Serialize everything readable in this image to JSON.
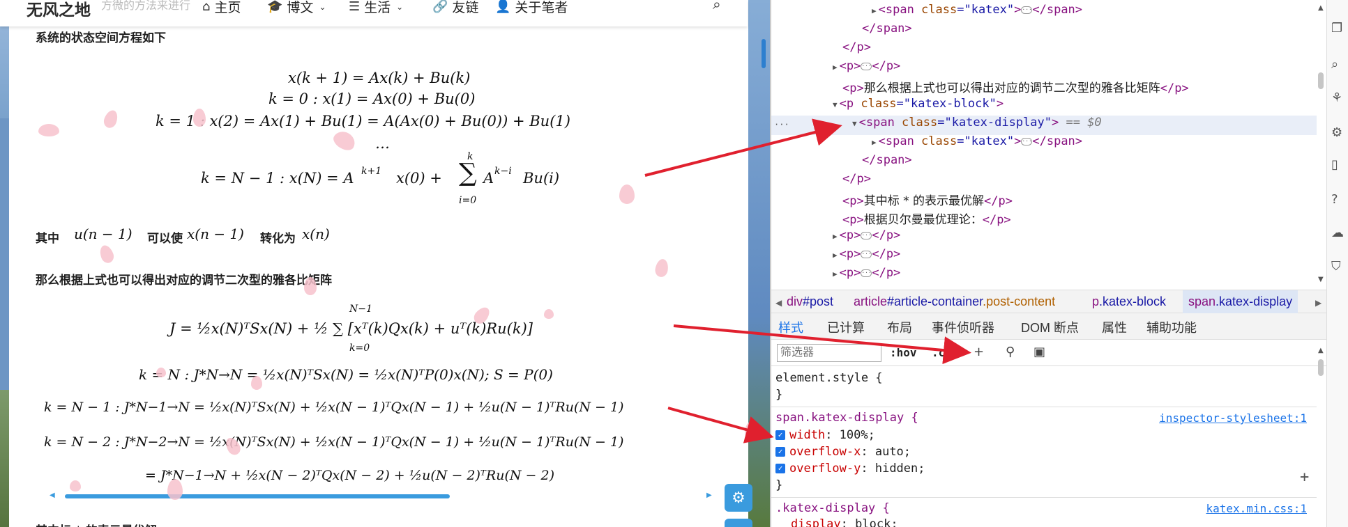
{
  "site": {
    "brand": "无风之地",
    "faded_text": "方微的方法来进行",
    "nav": [
      {
        "label": "主页",
        "icon": "home-icon",
        "glyph": "⌂",
        "dropdown": false
      },
      {
        "label": "博文",
        "icon": "graduation-cap-icon",
        "glyph": "🎓",
        "dropdown": true
      },
      {
        "label": "生活",
        "icon": "list-icon",
        "glyph": "☰",
        "dropdown": true
      },
      {
        "label": "友链",
        "icon": "link-icon",
        "glyph": "🔗",
        "dropdown": false
      },
      {
        "label": "关于笔者",
        "icon": "user-icon",
        "glyph": "👤",
        "dropdown": false
      }
    ],
    "search_icon": "⌕"
  },
  "article": {
    "p1": "系统的状态空间方程如下",
    "eq1": "x(k + 1) = Ax(k) + Bu(k)",
    "eq2": "k = 0 :  x(1) = Ax(0) + Bu(0)",
    "eq3": "k = 1 :  x(2) = Ax(1) + Bu(1) = A(Ax(0) + Bu(0)) + Bu(1)",
    "eq4": "…",
    "eq5_a": "k = N − 1 :  x(N) = A",
    "eq5_a_sup": "k+1",
    "eq5_b": "x(0) +",
    "eq5_sum": "∑",
    "eq5_sum_top": "k",
    "eq5_sum_bot": "i=0",
    "eq5_c": "A",
    "eq5_c_sup": "k−i",
    "eq5_d": "Bu(i)",
    "p2_pre": "其中",
    "p2_m1": "u(n − 1)",
    "p2_mid": "可以使",
    "p2_m2": "x(n − 1)",
    "p2_mid2": "转化为",
    "p2_m3": "x(n)",
    "p3": "那么根据上式也可以得出对应的调节二次型的雅各比矩阵",
    "eqJ": "J = ½x(N)ᵀSx(N) + ½ ∑ [xᵀ(k)Qx(k) + uᵀ(k)Ru(k)]",
    "eqJ_sum_top": "N−1",
    "eqJ_sum_bot": "k=0",
    "eqN": "k = N : J*N→N = ½x(N)ᵀSx(N) = ½x(N)ᵀP(0)x(N);  S = P(0)",
    "eqN1": "k = N − 1 : J*N−1→N = ½x(N)ᵀSx(N) + ½x(N − 1)ᵀQx(N − 1) + ½u(N − 1)ᵀRu(N − 1)",
    "eqN2": "k = N − 2 : J*N−2→N = ½x(N)ᵀSx(N) + ½x(N − 1)ᵀQx(N − 1) + ½u(N − 1)ᵀRu(N − 1)",
    "eqN2b": "= J*N−1→N + ½x(N − 2)ᵀQx(N − 2) + ½u(N − 2)ᵀRu(N − 2)",
    "p4_partial": "其中标 * 的表示最优解"
  },
  "devtools": {
    "elements": [
      {
        "indent": 1,
        "tri": "▶",
        "open": "<span",
        "attr": "class",
        "val": "katex",
        "close": ">",
        "ell": true,
        "end": "</span>"
      },
      {
        "indent": 0,
        "tri": "",
        "open": "</span>",
        "attr": "",
        "val": "",
        "close": "",
        "ell": false,
        "end": ""
      },
      {
        "indent": -1,
        "tri": "",
        "open": "</p>",
        "attr": "",
        "val": "",
        "close": "",
        "ell": false,
        "end": ""
      },
      {
        "indent": -1,
        "tri": "▶",
        "open": "<p>",
        "attr": "",
        "val": "",
        "close": "",
        "ell": true,
        "end": "</p>"
      },
      {
        "indent": -1,
        "tri": "",
        "open": "<p>",
        "attr": "",
        "val": "",
        "close": "",
        "ell": false,
        "end": "</p>",
        "text": "那么根据上式也可以得出对应的调节二次型的雅各比矩阵"
      },
      {
        "indent": -1,
        "tri": "▼",
        "open": "<p",
        "attr": "class",
        "val": "katex-block",
        "close": ">",
        "ell": false,
        "end": ""
      },
      {
        "indent": 0,
        "tri": "▼",
        "open": "<span",
        "attr": "class",
        "val": "katex-display",
        "close": ">",
        "ell": false,
        "end": "",
        "eq": "== $0"
      },
      {
        "indent": 1,
        "tri": "▶",
        "open": "<span",
        "attr": "class",
        "val": "katex",
        "close": ">",
        "ell": true,
        "end": "</span>"
      },
      {
        "indent": 0,
        "tri": "",
        "open": "</span>",
        "attr": "",
        "val": "",
        "close": "",
        "ell": false,
        "end": ""
      },
      {
        "indent": -1,
        "tri": "",
        "open": "</p>",
        "attr": "",
        "val": "",
        "close": "",
        "ell": false,
        "end": ""
      },
      {
        "indent": -1,
        "tri": "",
        "open": "<p>",
        "attr": "",
        "val": "",
        "close": "",
        "ell": false,
        "end": "</p>",
        "text": "其中标 * 的表示最优解"
      },
      {
        "indent": -1,
        "tri": "",
        "open": "<p>",
        "attr": "",
        "val": "",
        "close": "",
        "ell": false,
        "end": "</p>",
        "text": "根据贝尔曼最优理论："
      },
      {
        "indent": -1,
        "tri": "▶",
        "open": "<p>",
        "attr": "",
        "val": "",
        "close": "",
        "ell": true,
        "end": "</p>"
      },
      {
        "indent": -1,
        "tri": "▶",
        "open": "<p>",
        "attr": "",
        "val": "",
        "close": "",
        "ell": true,
        "end": "</p>"
      },
      {
        "indent": -1,
        "tri": "▶",
        "open": "<p>",
        "attr": "",
        "val": "",
        "close": "",
        "ell": true,
        "end": "</p>"
      }
    ],
    "ellipsis_dots": "···",
    "crumbs": [
      {
        "tag": "div",
        "cls": "#post",
        "prefix": "div"
      },
      {
        "tag": "article",
        "cls": "#article-container",
        "extra": ".post-content"
      },
      {
        "tag": "p",
        "cls": ".katex-block"
      },
      {
        "tag": "span",
        "cls": ".katex-display"
      }
    ],
    "tabs": [
      "样式",
      "已计算",
      "布局",
      "事件侦听器",
      "DOM 断点",
      "属性",
      "辅助功能"
    ],
    "filter_placeholder": "筛选器",
    "hov": ":hov",
    "cls": ".cls",
    "rules": {
      "element_style": "element.style {",
      "close": "}",
      "r1_sel": "span.katex-display {",
      "r1_src": "inspector-stylesheet:1",
      "r1_props": [
        [
          "width",
          "100%"
        ],
        [
          "overflow-x",
          "auto"
        ],
        [
          "overflow-y",
          "hidden"
        ]
      ],
      "r2_sel": ".katex-display {",
      "r2_src": "katex.min.css:1",
      "r2_prop": [
        "display",
        "block"
      ]
    },
    "plus": "+"
  },
  "colors": {
    "accent": "#3a9bde",
    "devtools_blue": "#1a73e8",
    "tag": "#881280",
    "attr": "#994500",
    "arrow": "#e0202e"
  }
}
